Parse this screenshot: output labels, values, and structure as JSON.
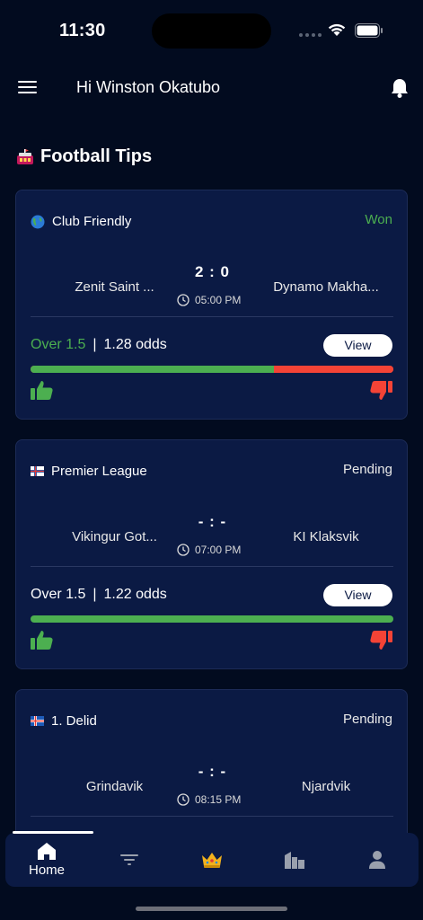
{
  "status_bar": {
    "time": "11:30"
  },
  "header": {
    "greeting": "Hi Winston Okatubo"
  },
  "section": {
    "title": "Football Tips"
  },
  "tips": [
    {
      "league": "Club Friendly",
      "status": "Won",
      "home": "Zenit Saint ...",
      "away": "Dynamo Makha...",
      "score": "2 : 0",
      "time": "05:00 PM",
      "pick": "Over 1.5",
      "odds": "1.28 odds",
      "view_label": "View",
      "upvote_share": 0.67
    },
    {
      "league": "Premier League",
      "status": "Pending",
      "home": "Vikingur Got...",
      "away": "KI Klaksvik",
      "score": "- : -",
      "time": "07:00 PM",
      "pick": "Over 1.5",
      "odds": "1.22 odds",
      "view_label": "View",
      "upvote_share": 1.0
    },
    {
      "league": "1. Delid",
      "status": "Pending",
      "home": "Grindavik",
      "away": "Njardvik",
      "score": "- : -",
      "time": "08:15 PM"
    }
  ],
  "bottom_nav": {
    "items": [
      {
        "label": "Home",
        "icon": "home-icon",
        "active": true
      },
      {
        "label": "",
        "icon": "filter-icon"
      },
      {
        "label": "",
        "icon": "crown-icon"
      },
      {
        "label": "",
        "icon": "buildings-icon"
      },
      {
        "label": "",
        "icon": "user-icon"
      }
    ]
  },
  "colors": {
    "background": "#020b1f",
    "card": "#0b1a44",
    "won": "#4caf50",
    "lost": "#f44336"
  }
}
